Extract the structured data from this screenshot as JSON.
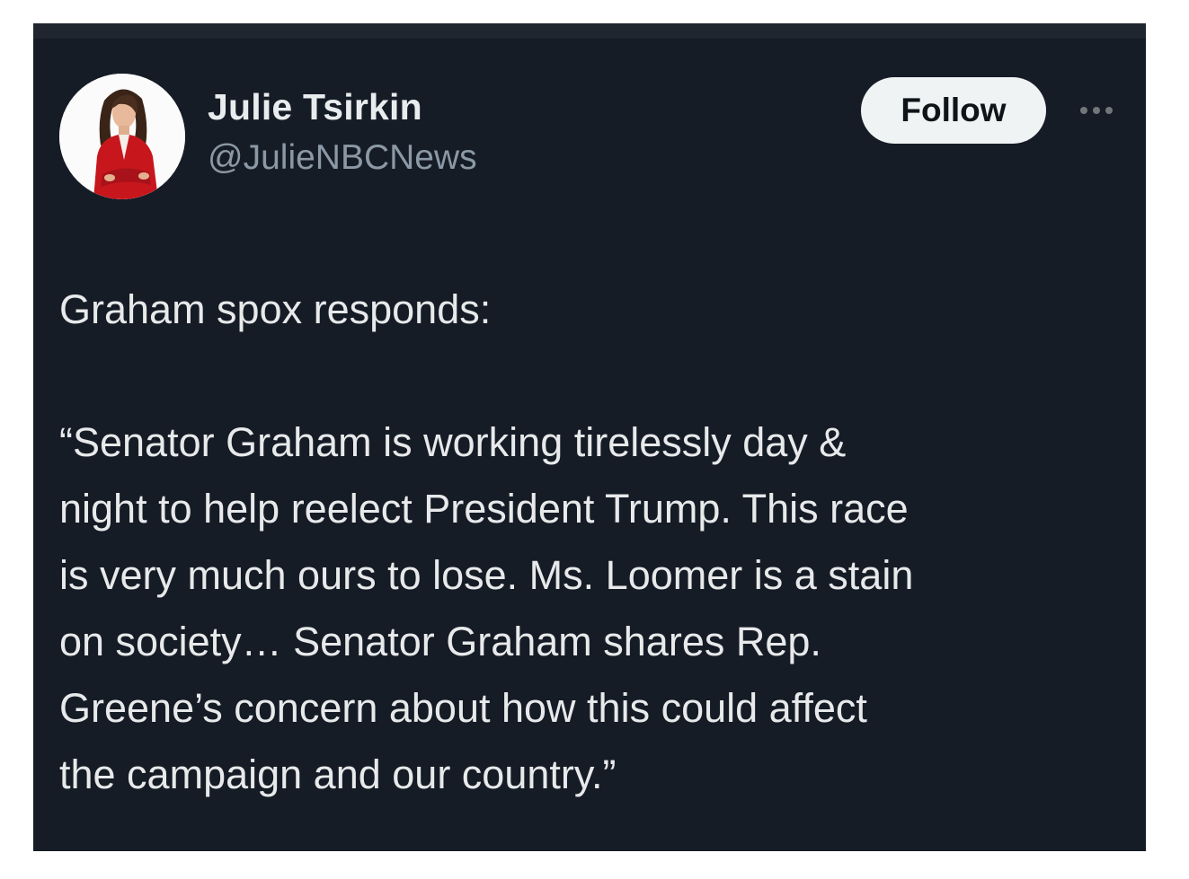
{
  "author": {
    "display_name": "Julie Tsirkin",
    "handle": "@JulieNBCNews"
  },
  "actions": {
    "follow_label": "Follow",
    "more_icon": "more-horizontal-icon"
  },
  "tweet": {
    "lines": [
      "Graham spox responds:",
      "“Senator Graham is working tirelessly day &",
      "night to help reelect President Trump. This race",
      "is very much ours to lose. Ms. Loomer is a stain",
      "on society… Senator Graham shares Rep.",
      "Greene’s concern about how this could affect",
      "the campaign and our country.”"
    ]
  },
  "colors": {
    "card_background": "#161c26",
    "text_primary": "#e7e9ea",
    "text_secondary": "#8b98a5",
    "follow_button_bg": "#eff3f4"
  }
}
